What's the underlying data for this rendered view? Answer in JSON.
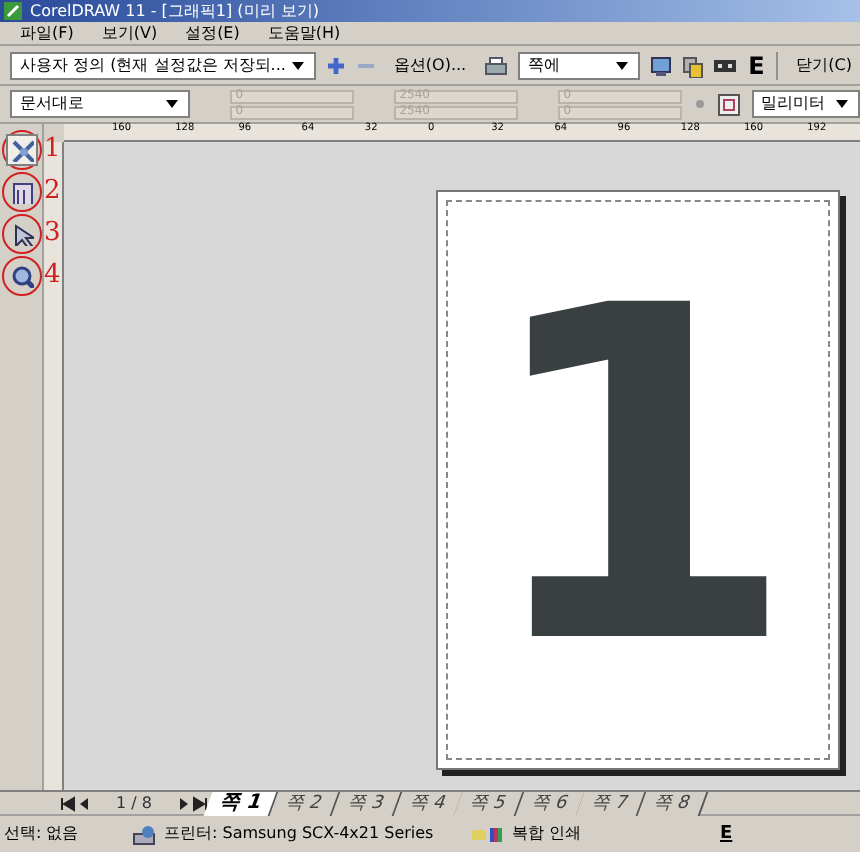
{
  "window": {
    "title": "CorelDRAW 11 - [그래픽1] (미리 보기)"
  },
  "menu": [
    "파일(F)",
    "보기(V)",
    "설정(E)",
    "도움말(H)"
  ],
  "toolbar": {
    "preset": "사용자 정의 (현재 설정값은 저장되...",
    "options_button": "옵션(O)...",
    "zoom": "쪽에",
    "e_button": "E",
    "close_button": "닫기(C)"
  },
  "position_bar": {
    "position": "문서대로",
    "fields": [
      {
        "value": "0",
        "disabled": true
      },
      {
        "value": "0",
        "disabled": true
      },
      {
        "value": "2540",
        "disabled": true
      },
      {
        "value": "2540",
        "disabled": true
      },
      {
        "value": "0",
        "disabled": true
      },
      {
        "value": "0",
        "disabled": true
      }
    ],
    "units": "밀리미터"
  },
  "ruler": [
    "160",
    "128",
    "96",
    "64",
    "32",
    "0",
    "32",
    "64",
    "96",
    "128",
    "160",
    "192"
  ],
  "tools": [
    {
      "selected": true
    },
    {
      "selected": false
    },
    {
      "selected": false
    },
    {
      "selected": false
    }
  ],
  "annotations": [
    "1",
    "2",
    "3",
    "4"
  ],
  "page": {
    "content": "1"
  },
  "pager": {
    "position": "1 / 8",
    "tabs": [
      {
        "label": "쪽 1",
        "selected": true
      },
      {
        "label": "쪽 2",
        "selected": false
      },
      {
        "label": "쪽 3",
        "selected": false
      },
      {
        "label": "쪽 4",
        "selected": false
      },
      {
        "label": "쪽 5",
        "selected": false
      },
      {
        "label": "쪽 6",
        "selected": false
      },
      {
        "label": "쪽 7",
        "selected": false
      },
      {
        "label": "쪽 8",
        "selected": false
      }
    ]
  },
  "status_bar": {
    "selection": "선택: 없음",
    "printer": "프린터: Samsung SCX-4x21 Series",
    "mode": "복합 인쇄",
    "mark": "E"
  }
}
